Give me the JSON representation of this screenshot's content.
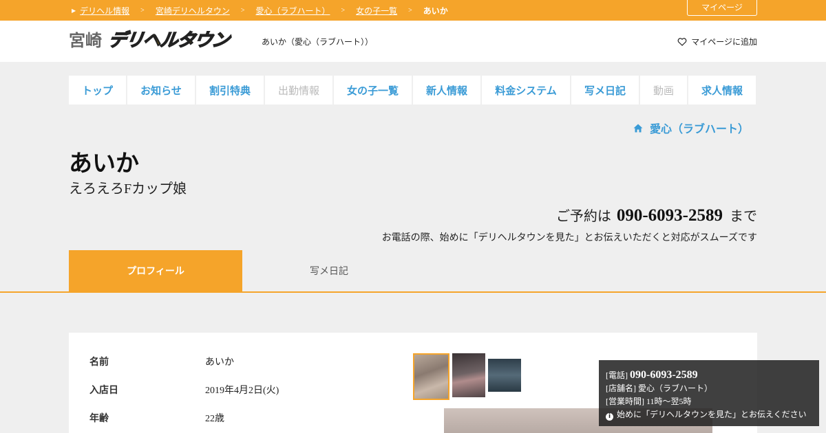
{
  "breadcrumb": {
    "items": [
      "デリヘル情報",
      "宮崎デリヘルタウン",
      "愛心（ラブハート）",
      "女の子一覧"
    ],
    "separator": ">",
    "current": "あいか"
  },
  "mypage_label": "マイページ",
  "header": {
    "logo_city": "宮崎",
    "logo_text": "デリヘルタウン",
    "shop_name": "あいか（愛心（ラブハート））",
    "add_favorite": "マイページに追加"
  },
  "nav": [
    {
      "label": "トップ",
      "enabled": true
    },
    {
      "label": "お知らせ",
      "enabled": true
    },
    {
      "label": "割引特典",
      "enabled": true
    },
    {
      "label": "出勤情報",
      "enabled": false
    },
    {
      "label": "女の子一覧",
      "enabled": true
    },
    {
      "label": "新人情報",
      "enabled": true
    },
    {
      "label": "料金システム",
      "enabled": true
    },
    {
      "label": "写メ日記",
      "enabled": true
    },
    {
      "label": "動画",
      "enabled": false
    },
    {
      "label": "求人情報",
      "enabled": true
    }
  ],
  "shop_link": "愛心（ラブハート）",
  "girl": {
    "name": "あいか",
    "catchphrase": "えろえろFカップ娘"
  },
  "reserve": {
    "prefix": "ご予約は",
    "tel": "090-6093-2589",
    "suffix": "まで",
    "note": "お電話の際、始めに「デリヘルタウンを見た」とお伝えいただくと対応がスムーズです"
  },
  "tabs": [
    {
      "label": "プロフィール",
      "active": true
    },
    {
      "label": "写メ日記",
      "active": false
    }
  ],
  "profile": [
    {
      "label": "名前",
      "value": "あいか"
    },
    {
      "label": "入店日",
      "value": "2019年4月2日(火)"
    },
    {
      "label": "年齢",
      "value": "22歳"
    }
  ],
  "popup": {
    "tel_label": "[電話]",
    "tel": "090-6093-2589",
    "shop_label": "[店舗名]",
    "shop": "愛心（ラブハート）",
    "hours_label": "[営業時間]",
    "hours": "11時～翌5時",
    "note": "始めに「デリヘルタウンを見た」とお伝えください"
  },
  "colors": {
    "accent": "#f5a42a",
    "link": "#3a9bd6",
    "background": "#efefef"
  }
}
